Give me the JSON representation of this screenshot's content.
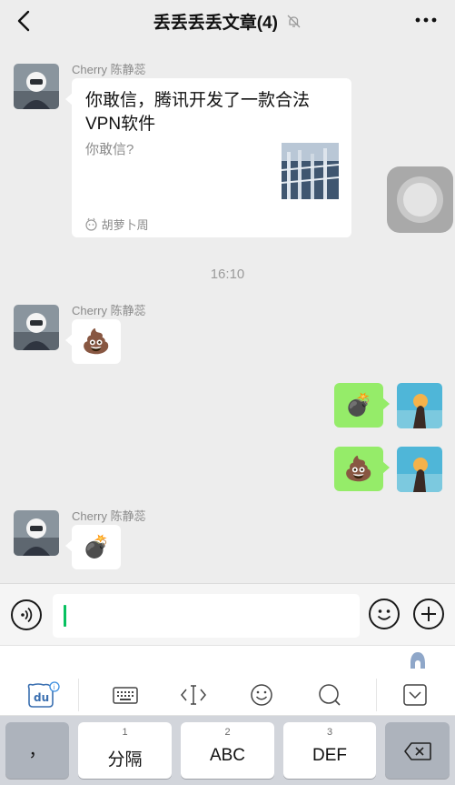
{
  "header": {
    "title": "丢丢丢丢文章(4)",
    "back_icon": "chevron-left-icon",
    "muted_icon": "bell-muted-icon",
    "more_icon": "more-dots-icon"
  },
  "messages": {
    "m1": {
      "sender": "Cherry 陈静蕊",
      "article_title": "你敢信，腾讯开发了一款合法VPN软件",
      "article_desc": "你敢信?",
      "source": "胡萝卜周"
    },
    "time": "16:10",
    "m2": {
      "sender": "Cherry 陈静蕊",
      "emoji": "💩"
    },
    "m3": {
      "emoji": "💣"
    },
    "m4": {
      "emoji": "💩"
    },
    "m5": {
      "sender": "Cherry 陈静蕊",
      "emoji": "💣"
    }
  },
  "input": {
    "value": "",
    "voice_icon": "voice-icon",
    "emoji_icon": "smiley-icon",
    "plus_icon": "plus-icon"
  },
  "keyboard": {
    "toolbar_icons": [
      "du-logo-icon",
      "keyboard-icon",
      "cursor-move-icon",
      "emoji-icon",
      "search-icon",
      "collapse-keyboard-icon"
    ],
    "keys": {
      "comma": "，",
      "k1_num": "1",
      "k1_label": "分隔",
      "k2_num": "2",
      "k2_label": "ABC",
      "k3_num": "3",
      "k3_label": "DEF",
      "backspace_icon": "backspace-icon"
    }
  },
  "colors": {
    "accent_green": "#07c160",
    "bubble_green": "#95ec69",
    "background": "#ededed"
  }
}
